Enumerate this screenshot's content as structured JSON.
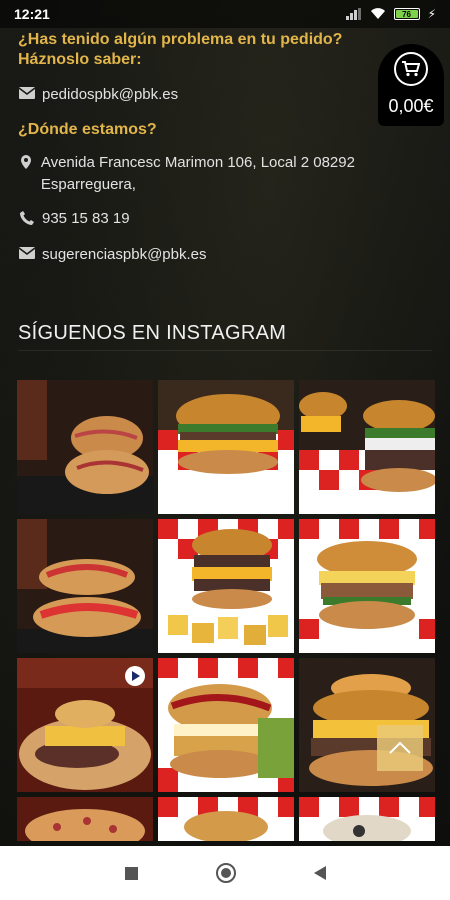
{
  "status_bar": {
    "time": "12:21",
    "battery": "76"
  },
  "contact": {
    "problem_heading": "¿Has tenido algún problema en tu pedido? Házn oslo saber:",
    "orders_email": "pedidospbk@pbk.es",
    "location_heading": "¿Dónde estamos?",
    "address": "Avenida Francesc Marimon 106, Local 2 08292 Esparreguera,",
    "phone": "935 15 83 19",
    "suggestions_email": "sugerenciaspbk@pbk.es"
  },
  "instagram": {
    "title": "SÍGUENOS EN INSTAGRAM",
    "photos": [
      "wraps-photo",
      "burger-photo",
      "burgers-photo",
      "wraps-photo",
      "burger-fries-photo",
      "burger-photo",
      "burger-video",
      "burger-photo",
      "burger-photo",
      "pizza-photo",
      "burger-photo",
      "burger-photo"
    ]
  },
  "cart": {
    "amount": "0,00€",
    "icon": "shopping-cart-icon"
  },
  "colors": {
    "accent": "#e1b54a",
    "background": "#111111",
    "scroll_top": "#e9c878"
  }
}
